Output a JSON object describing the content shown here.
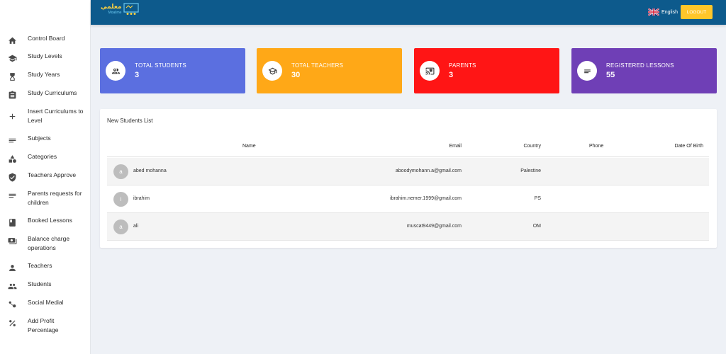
{
  "brand": {
    "arabic": "معلمي",
    "latin": "Moalime"
  },
  "header": {
    "language": "English",
    "logout_label": "LOGOUT"
  },
  "sidebar": {
    "items": [
      {
        "label": "Control Board",
        "icon": "home-icon"
      },
      {
        "label": "Study Levels",
        "icon": "graduation-cap-icon"
      },
      {
        "label": "Study Years",
        "icon": "hourglass-icon"
      },
      {
        "label": "Study Curriculums",
        "icon": "clipboard-icon"
      },
      {
        "label": "Insert Curriculums to Level",
        "icon": "plus-icon"
      },
      {
        "label": "Subjects",
        "icon": "list-icon"
      },
      {
        "label": "Categories",
        "icon": "shapes-icon"
      },
      {
        "label": "Teachers Approve",
        "icon": "shield-check-icon"
      },
      {
        "label": "Parents requests for children",
        "icon": "list-icon"
      },
      {
        "label": "Booked Lessons",
        "icon": "book-icon"
      },
      {
        "label": "Balance charge operations",
        "icon": "money-icon"
      },
      {
        "label": "Teachers",
        "icon": "person-icon"
      },
      {
        "label": "Students",
        "icon": "people-icon"
      },
      {
        "label": "Social Medial",
        "icon": "social-icon"
      },
      {
        "label": "Add Profit Percentage",
        "icon": "percent-icon"
      }
    ]
  },
  "stats": [
    {
      "title": "TOTAL STUDENTS",
      "value": "3",
      "color": "#5b6fe0",
      "icon": "people-outline-icon"
    },
    {
      "title": "TOTAL TEACHERS",
      "value": "30",
      "color": "#ffa817",
      "icon": "graduation-cap-icon"
    },
    {
      "title": "PARENTS",
      "value": "3",
      "color": "#ff1515",
      "icon": "cast-icon"
    },
    {
      "title": "REGISTERED LESSONS",
      "value": "55",
      "color": "#6f3fb6",
      "icon": "list-icon"
    }
  ],
  "students_list": {
    "title": "New Students List",
    "columns": {
      "name": "Name",
      "email": "Email",
      "country": "Country",
      "phone": "Phone",
      "dob": "Date Of Birth"
    },
    "rows": [
      {
        "initial": "a",
        "name": "abed mohanna",
        "email": "aboodymohann.a@gmail.com",
        "country": "Palestine",
        "phone": "",
        "dob": ""
      },
      {
        "initial": "i",
        "name": "ibrahim",
        "email": "ibrahim.nemer.1999@gmail.com",
        "country": "PS",
        "phone": "",
        "dob": ""
      },
      {
        "initial": "a",
        "name": "ali",
        "email": "muscat9449@gmail.com",
        "country": "OM",
        "phone": "",
        "dob": ""
      }
    ]
  }
}
